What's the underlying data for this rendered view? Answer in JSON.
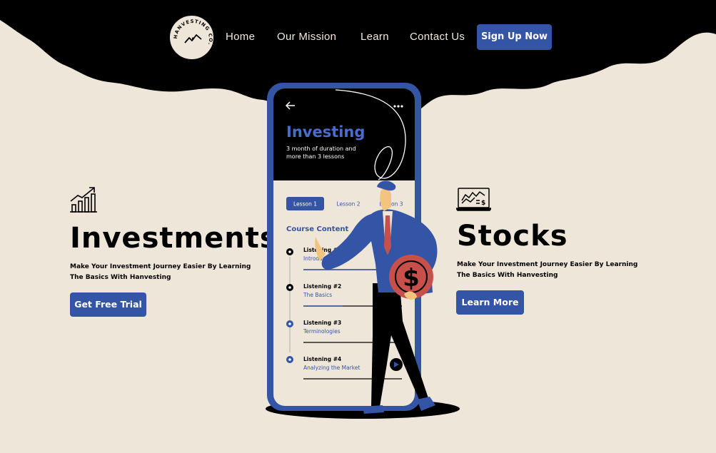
{
  "brand": {
    "logo_text": "HANVESTING CO."
  },
  "nav": {
    "items": [
      {
        "label": "Home"
      },
      {
        "label": "Our Mission"
      },
      {
        "label": "Learn"
      },
      {
        "label": "Contact Us"
      }
    ],
    "cta_label": "Sign Up Now"
  },
  "investments": {
    "title": "Investments",
    "description": "Make Your Investment Journey Easier By Learning The Basics With Hanvesting",
    "cta_label": "Get Free Trial",
    "icon": "growth-chart-icon"
  },
  "stocks": {
    "title": "Stocks",
    "description": "Make Your Investment Journey Easier By Learning The Basics With Hanvesting",
    "cta_label": "Learn More",
    "icon": "laptop-stocks-icon"
  },
  "phone": {
    "title": "Investing",
    "subtitle_line1": "3 month of duration and",
    "subtitle_line2": "more than 3 lessons",
    "tabs": [
      "Lesson 1",
      "Lesson 2",
      "Lesson 3"
    ],
    "section_title": "Course Content",
    "lessons": [
      {
        "label": "Listening #1",
        "name": "Introduction",
        "progress": 0.9
      },
      {
        "label": "Listening #2",
        "name": "The Basics",
        "progress": 0.4
      },
      {
        "label": "Listening #3",
        "name": "Terminologies",
        "progress": 0
      },
      {
        "label": "Listening #4",
        "name": "Analyzing the Market",
        "progress": 0
      }
    ]
  },
  "colors": {
    "accent": "#3454a6",
    "background": "#efe6da",
    "ink": "#000000",
    "coin": "#c8504a"
  }
}
